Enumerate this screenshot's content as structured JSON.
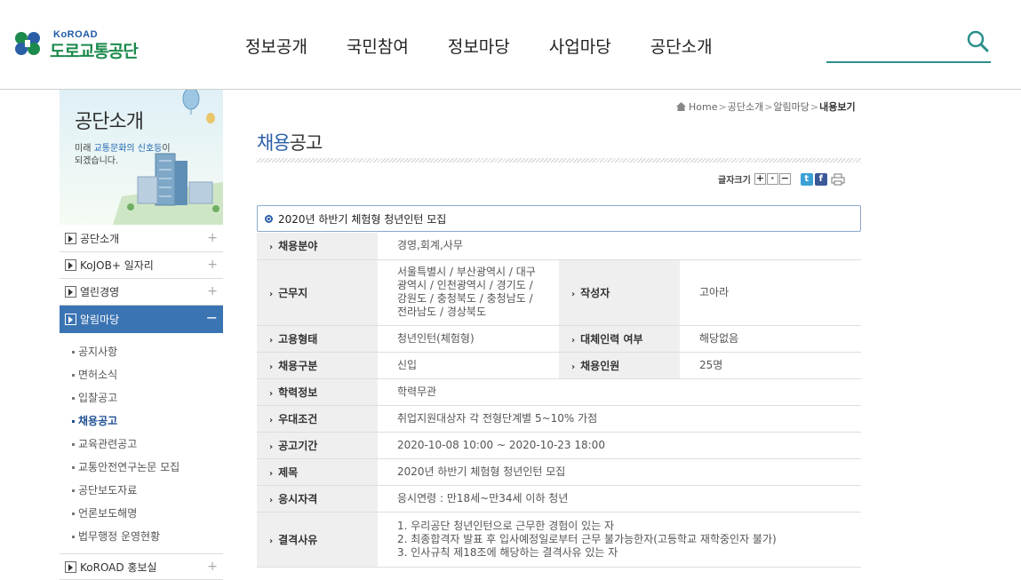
{
  "header": {
    "logo_en": "KoROAD",
    "logo_ko": "도로교통공단",
    "nav": [
      "정보공개",
      "국민참여",
      "정보마당",
      "사업마당",
      "공단소개"
    ],
    "accent": "#2c8f8c"
  },
  "sidebar": {
    "visual_title": "공단소개",
    "visual_sub_1": "미래 ",
    "visual_sub_hl": "교통문화의 신호등",
    "visual_sub_2": "이",
    "visual_sub_3": "되겠습니다.",
    "menu": [
      {
        "label": "공단소개"
      },
      {
        "label": "KoJOB+ 일자리"
      },
      {
        "label": "열린경영"
      },
      {
        "label": "알림마당",
        "active": true
      },
      {
        "label": "KoROAD 홍보실"
      }
    ],
    "submenu": [
      "공지사항",
      "면허소식",
      "입찰공고",
      "채용공고",
      "교육관련공고",
      "교통안전연구논문 모집",
      "공단보도자료",
      "언론보도해명",
      "법무행정 운영현황"
    ],
    "current_sub": "채용공고"
  },
  "breadcrumb": {
    "home": "Home",
    "sep": ">",
    "items": [
      "공단소개",
      "알림마당"
    ],
    "last": "내용보기"
  },
  "page": {
    "title_hl": "채용",
    "title_rest": "공고"
  },
  "tools": {
    "font_size_label": "글자크기",
    "plus": "+",
    "reset": "·",
    "minus": "−",
    "twitter": "t",
    "facebook": "f"
  },
  "post": {
    "title": "2020년 하반기 체험형 청년인턴 모집",
    "arrow": "›",
    "field_label": "채용분야",
    "field": "경영,회계,사무",
    "location_label": "근무지",
    "location_lines": [
      "서울특별시 / 부산광역시 / 대구",
      "광역시 / 인천광역시 / 경기도 /",
      "강원도 / 충청북도 / 충청남도 /",
      "전라남도 / 경상북도"
    ],
    "author_label": "작성자",
    "author": "고아라",
    "employment_label": "고용형태",
    "employment": "청년인턴(체험형)",
    "substitute_label": "대체인력 여부",
    "substitute": "해당없음",
    "category_label": "채용구분",
    "category": "신입",
    "headcount_label": "채용인원",
    "headcount": "25명",
    "education_label": "학력정보",
    "education": "학력무관",
    "preference_label": "우대조건",
    "preference": "취업지원대상자 각 전형단계별 5~10% 가점",
    "period_label": "공고기간",
    "period": "2020-10-08 10:00 ~ 2020-10-23 18:00",
    "subject_label": "제목",
    "subject": "2020년 하반기 체험형 청년인턴 모집",
    "qualification_label": "응시자격",
    "qualification": "응시연령 : 만18세~만34세 이하 청년",
    "disqualify_label": "결격사유",
    "disqualify_lines": [
      "1. 우리공단 청년인턴으로 근무한 경험이 있는 자",
      "2. 최종합격자 발표 후 입사예정일로부터 근무 불가능한자(고등학교 재학중인자 불가)",
      "3. 인사규칙 제18조에 해당하는 결격사유 있는 자"
    ]
  }
}
